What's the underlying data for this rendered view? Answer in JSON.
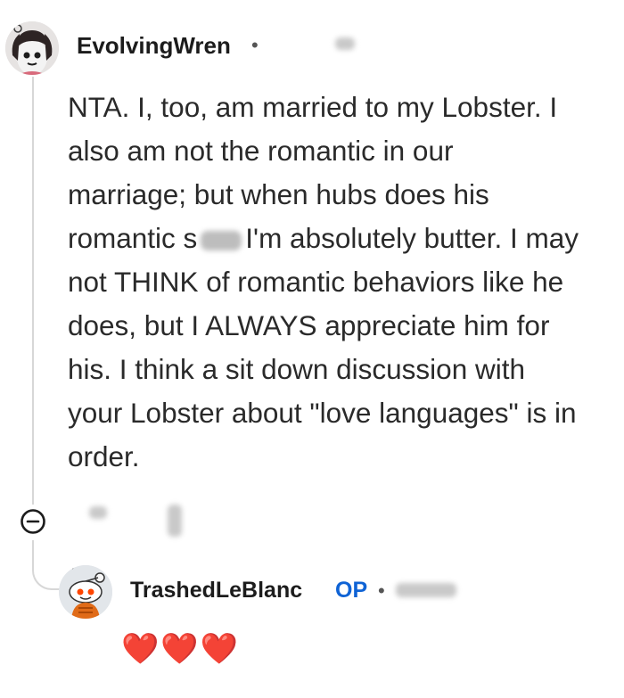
{
  "comment": {
    "username": "EvolvingWren",
    "separator": "•",
    "body_lines": [
      {
        "text": "NTA. I, too, am married to my Lobster. I"
      },
      {
        "text": "also am not the romantic in our"
      },
      {
        "text": "marriage; but when hubs does his"
      },
      {
        "before": "romantic s",
        "after": "I'm absolutely butter. I may"
      },
      {
        "text": "not THINK of romantic behaviors like he"
      },
      {
        "text": "does, but I ALWAYS appreciate him for"
      },
      {
        "text": "his. I think a sit down discussion with"
      },
      {
        "text": "your Lobster about \"love languages\" is in"
      },
      {
        "text": "order."
      }
    ]
  },
  "reply": {
    "username": "TrashedLeBlanc",
    "badge": "OP",
    "separator": "•",
    "body": "❤️❤️❤️"
  },
  "icons": {
    "collapse": "minus-circle-icon",
    "avatar_1": "snoo-avatar-dark-hair",
    "avatar_2": "snoo-avatar-orange"
  },
  "colors": {
    "op_badge": "#0f63d5",
    "thread_line": "#d7d7d7",
    "heart": "#e0132a"
  }
}
